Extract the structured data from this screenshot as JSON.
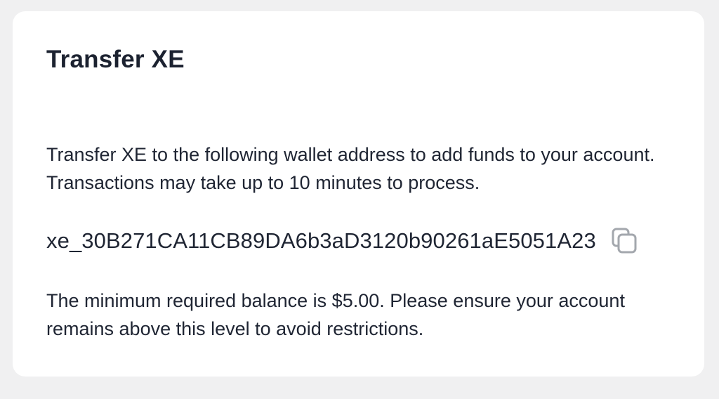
{
  "card": {
    "title": "Transfer XE",
    "description": "Transfer XE to the following wallet address to add funds to your account. Transactions may take up to 10 minutes to process.",
    "wallet_address": "xe_30B271CA11CB89DA6b3aD3120b90261aE5051A23",
    "copy_icon": "copy-icon",
    "minimum_balance_note": "The minimum required balance is $5.00. Please ensure your account remains above this level to avoid restrictions."
  },
  "colors": {
    "background": "#f0f0f1",
    "card": "#ffffff",
    "text": "#1f2533",
    "icon": "#a3a7ad"
  }
}
